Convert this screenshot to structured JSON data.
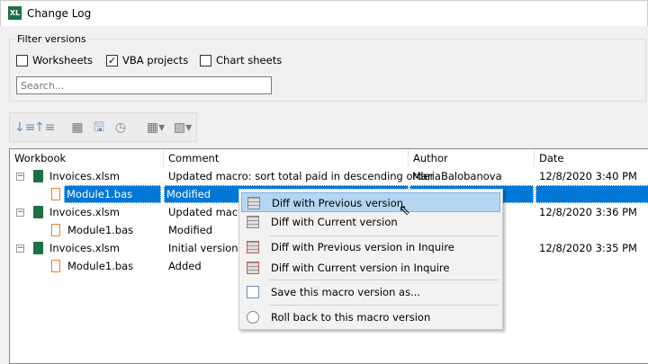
{
  "window": {
    "title": "Change Log",
    "app_icon": "XL"
  },
  "filter": {
    "group_label": "Filter versions",
    "worksheets": {
      "label": "Worksheets",
      "checked": false
    },
    "vba": {
      "label": "VBA projects",
      "checked": true
    },
    "charts": {
      "label": "Chart sheets",
      "checked": false
    },
    "search_placeholder": "Search..."
  },
  "toolbar": {
    "icons": [
      "expand-all-icon",
      "collapse-all-icon",
      "preview-icon",
      "save-icon",
      "rollback-icon",
      "compare-dropdown-icon",
      "inquire-dropdown-icon"
    ]
  },
  "tree": {
    "columns": [
      "Workbook",
      "Comment",
      "Author",
      "Date"
    ],
    "rows": [
      {
        "name": "Invoices.xlsm",
        "comment": "Updated macro: sort total paid in descending order",
        "author": "MariaBalobanova",
        "date": "12/8/2020 3:40 PM"
      },
      {
        "name": "Module1.bas",
        "comment": "Modified",
        "author": "",
        "date": ""
      },
      {
        "name": "Invoices.xlsm",
        "comment": "Updated macro",
        "author": "",
        "date": "12/8/2020 3:36 PM"
      },
      {
        "name": "Module1.bas",
        "comment": "Modified",
        "author": "",
        "date": ""
      },
      {
        "name": "Invoices.xlsm",
        "comment": "Initial version",
        "author": "",
        "date": "12/8/2020 3:35 PM"
      },
      {
        "name": "Module1.bas",
        "comment": "Added",
        "author": "",
        "date": ""
      }
    ]
  },
  "menu": {
    "items": [
      "Diff with Previous version",
      "Diff with Current version",
      "Diff with Previous version in Inquire",
      "Diff with Current version in Inquire",
      "Save this macro version as...",
      "Roll back to this macro version"
    ]
  },
  "colors": {
    "selection": "#0078d7",
    "menu_highlight": "#b4d6f3",
    "excel_green": "#1e7145",
    "bas_orange": "#f07b2a"
  }
}
